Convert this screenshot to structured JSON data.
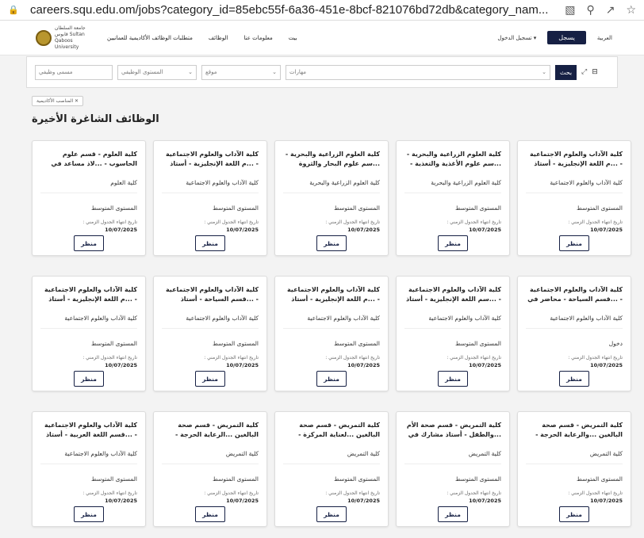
{
  "browser": {
    "url": "careers.squ.edu.om/jobs?category_id=85ebc55f-6a36-451e-8bcf-821076bd72db&category_nam..."
  },
  "nav": {
    "logo_text": "جامعة السلطان قابوس Sultan Qaboos University",
    "home": "بيت",
    "about": "معلومات عنا",
    "jobs": "الوظائف",
    "requirements": "متطلبات الوظائف الأكاديمية للعمانيين",
    "login": "تسجيل الدخول",
    "register": "يسجل",
    "lang": "العربية"
  },
  "filters": {
    "job_title": "مسمى وظيفي",
    "career_level": "المستوى الوظيفي",
    "location": "موقع",
    "skills": "مهارات",
    "search": "بحث"
  },
  "chip": "المناصب الأكاديمية",
  "heading": "الوظائف الشاغرة الأخيرة",
  "deadline_label": "تاريخ انتهاء الجدول الزمني :",
  "view_label": "منظر",
  "cards": [
    {
      "title": "كلية العلوم - قسم علوم الحاسوب - ...لاذ مساعد في الذكاء الاصطناعي",
      "college": "كلية العلوم",
      "level": "المستوى المتوسط",
      "date": "10/07/2025"
    },
    {
      "title": "كلية الآداب والعلوم الاجتماعية - ...م اللغة الإنجليزية - أستاذ مشارك",
      "college": "كلية الآداب والعلوم الاجتماعية",
      "level": "المستوى المتوسط",
      "date": "10/07/2025"
    },
    {
      "title": "كلية العلوم الزراعية والبحرية - ...سم علوم البحار والثروة السمكية -",
      "college": "كلية العلوم الزراعية والبحرية",
      "level": "المستوى المتوسط",
      "date": "10/07/2025"
    },
    {
      "title": "كلية العلوم الزراعية والبحرية - ...سم علوم الأغذية والتغذية - أستاذ",
      "college": "كلية العلوم الزراعية والبحرية",
      "level": "المستوى المتوسط",
      "date": "10/07/2025"
    },
    {
      "title": "كلية الآداب والعلوم الاجتماعية - ...م اللغة الإنجليزية - أستاذ مشارك",
      "college": "كلية الآداب والعلوم الاجتماعية",
      "level": "المستوى المتوسط",
      "date": "10/07/2025"
    },
    {
      "title": "كلية الآداب والعلوم الاجتماعية - ...م اللغة الإنجليزية - أستاذ مشارك",
      "college": "كلية الآداب والعلوم الاجتماعية",
      "level": "المستوى المتوسط",
      "date": "10/07/2025"
    },
    {
      "title": "كلية الآداب والعلوم الاجتماعية - ...قسم السياحة - أستاذ مشارك في",
      "college": "كلية الآداب والعلوم الاجتماعية",
      "level": "المستوى المتوسط",
      "date": "10/07/2025"
    },
    {
      "title": "كلية الآداب والعلوم الاجتماعية - ...م اللغة الإنجليزية - أستاذ مساعد",
      "college": "كلية الآداب والعلوم الاجتماعية",
      "level": "المستوى المتوسط",
      "date": "10/07/2025"
    },
    {
      "title": "كلية الآداب والعلوم الاجتماعية - ...سم اللغة الإنجليزية - أستاذ مساعد",
      "college": "كلية الآداب والعلوم الاجتماعية",
      "level": "المستوى المتوسط",
      "date": "10/07/2025"
    },
    {
      "title": "كلية الآداب والعلوم الاجتماعية - ...قسم السياحة - محاضر في اللغة",
      "college": "كلية الآداب والعلوم الاجتماعية",
      "level": "دخول",
      "date": "10/07/2025"
    },
    {
      "title": "كلية الآداب والعلوم الاجتماعية - ...قسم اللغة العربية - أستاذ مساعد",
      "college": "كلية الآداب والعلوم الاجتماعية",
      "level": "المستوى المتوسط",
      "date": "10/07/2025"
    },
    {
      "title": "كلية التمريض - قسم صحة البالغين ...الرعاية الحرجة - أستاذ مشارك في",
      "college": "كلية التمريض",
      "level": "المستوى المتوسط",
      "date": "10/07/2025"
    },
    {
      "title": "كلية التمريض - قسم صحة البالغين ...لعناية المركزة - أستاذ مشارك في",
      "college": "كلية التمريض",
      "level": "المستوى المتوسط",
      "date": "10/07/2025"
    },
    {
      "title": "كلية التمريض - قسم صحة الأم ...والطفل - أستاذ مشارك في صحة",
      "college": "كلية التمريض",
      "level": "المستوى المتوسط",
      "date": "10/07/2025"
    },
    {
      "title": "كلية التمريض - قسم صحة البالغين ...والرعاية الحرجة - أستاذ مساعد في",
      "college": "كلية التمريض",
      "level": "المستوى المتوسط",
      "date": "10/07/2025"
    }
  ]
}
